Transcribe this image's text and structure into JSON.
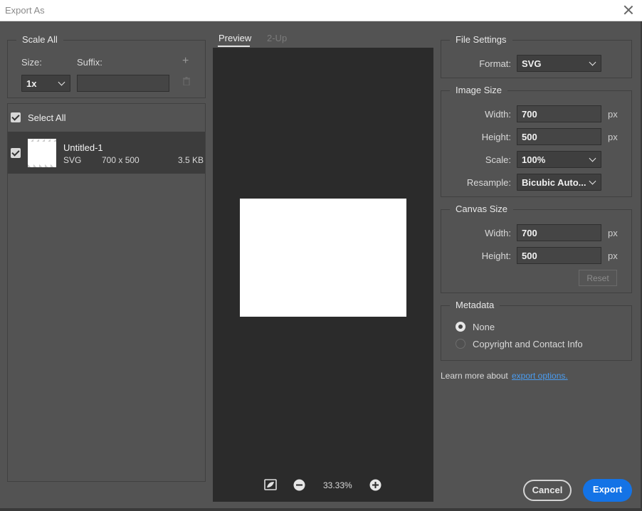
{
  "window": {
    "title": "Export As"
  },
  "scale_all": {
    "heading": "Scale All",
    "size_label": "Size:",
    "suffix_label": "Suffix:",
    "size_value": "1x",
    "suffix_value": "",
    "add_icon": "plus-icon",
    "delete_icon": "trash-icon"
  },
  "asset_list": {
    "select_all_label": "Select All",
    "items": [
      {
        "name": "Untitled-1",
        "format": "SVG",
        "dimensions": "700 x 500",
        "size": "3.5 KB",
        "checked": true
      }
    ]
  },
  "preview": {
    "tabs": [
      {
        "label": "Preview",
        "active": true
      },
      {
        "label": "2-Up",
        "active": false
      }
    ],
    "zoom": "33.33%",
    "icons": {
      "toggle": "checkerboard-toggle-icon",
      "zoom_out": "zoom-out-icon",
      "zoom_in": "zoom-in-icon"
    }
  },
  "file_settings": {
    "heading": "File Settings",
    "format_label": "Format:",
    "format_value": "SVG"
  },
  "image_size": {
    "heading": "Image Size",
    "width_label": "Width:",
    "width_value": "700",
    "height_label": "Height:",
    "height_value": "500",
    "unit": "px",
    "scale_label": "Scale:",
    "scale_value": "100%",
    "resample_label": "Resample:",
    "resample_value": "Bicubic Auto..."
  },
  "canvas_size": {
    "heading": "Canvas Size",
    "width_label": "Width:",
    "width_value": "700",
    "height_label": "Height:",
    "height_value": "500",
    "unit": "px",
    "reset_label": "Reset"
  },
  "metadata": {
    "heading": "Metadata",
    "options": [
      {
        "label": "None",
        "selected": true
      },
      {
        "label": "Copyright and Contact Info",
        "selected": false
      }
    ]
  },
  "footer": {
    "learn_more_text": "Learn more about",
    "learn_more_link": "export options.",
    "cancel_label": "Cancel",
    "export_label": "Export"
  },
  "colors": {
    "accent": "#1473e6",
    "link": "#4a9cf0",
    "panel": "#535353",
    "preview_bg": "#2b2b2b"
  }
}
